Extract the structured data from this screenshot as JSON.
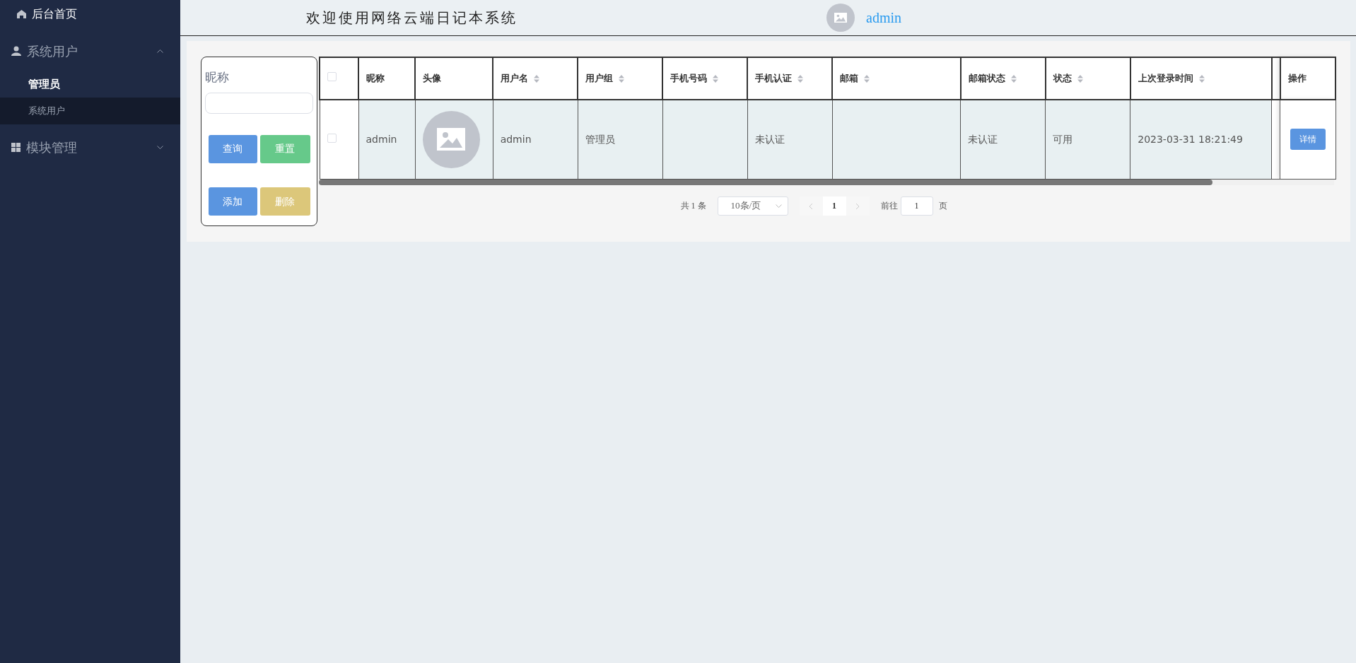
{
  "sidebar": {
    "items": [
      {
        "label": "后台首页",
        "kind": "link"
      },
      {
        "label": "系统用户",
        "kind": "group",
        "expanded": true,
        "children": [
          {
            "label": "管理员",
            "selected": true,
            "hover": false
          },
          {
            "label": "系统用户",
            "selected": false,
            "hover": true
          }
        ]
      },
      {
        "label": "模块管理",
        "kind": "group",
        "expanded": false
      }
    ]
  },
  "header": {
    "title": "欢迎使用网络云端日记本系统",
    "user": "admin"
  },
  "filter": {
    "label": "昵称",
    "buttons": [
      {
        "label": "查询",
        "kind": "primary"
      },
      {
        "label": "重置",
        "kind": "success"
      },
      {
        "label": "添加",
        "kind": "primary"
      },
      {
        "label": "删除",
        "kind": "warning"
      }
    ]
  },
  "table": {
    "select_all": false,
    "columns": [
      {
        "label": "昵称",
        "sortable": false
      },
      {
        "label": "头像",
        "sortable": false
      },
      {
        "label": "用户名",
        "sortable": true
      },
      {
        "label": "用户组",
        "sortable": true
      },
      {
        "label": "手机号码",
        "sortable": true
      },
      {
        "label": "手机认证",
        "sortable": true
      },
      {
        "label": "邮箱",
        "sortable": true
      },
      {
        "label": "邮箱状态",
        "sortable": true
      },
      {
        "label": "状态",
        "sortable": true
      },
      {
        "label": "上次登录时间",
        "sortable": true
      },
      {
        "label": "操作",
        "sortable": false
      }
    ],
    "rows": [
      {
        "checked": false,
        "cells": [
          "admin",
          null,
          "admin",
          "管理员",
          "",
          "未认证",
          "",
          "未认证",
          "可用",
          "2023-03-31 18:21:49"
        ],
        "action": "详情"
      }
    ]
  },
  "pagination": {
    "total": "共 1 条",
    "page_size": "10条/页",
    "prev_disabled": true,
    "next_disabled": true,
    "pages": [
      {
        "label": "1",
        "selected": true
      }
    ],
    "goto_label": "前往",
    "goto_value": "1",
    "goto_suffix": "页"
  }
}
